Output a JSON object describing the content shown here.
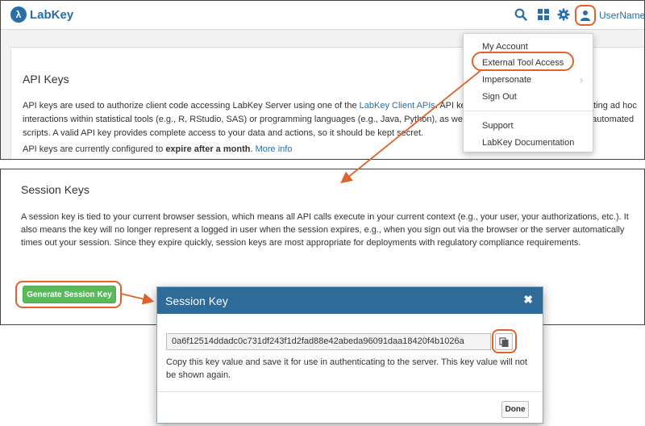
{
  "header": {
    "logo_text": "LabKey",
    "username": "UserName"
  },
  "api_keys": {
    "title": "API Keys",
    "text_part1": "API keys are used to authorize client code accessing LabKey Server using one of the ",
    "link_client_apis": "LabKey Client APIs",
    "text_part2": ". API keys are appropriate for authenticating ad hoc interactions within statistical tools (e.g., R, RStudio, SAS) or programming languages (e.g., Java, Python), as well as authenticating API use from automated scripts. A valid API key provides complete access to your data and actions, so it should be kept secret.",
    "config_text": "API keys are currently configured to ",
    "config_bold": "expire after a month",
    "config_period": ".",
    "more_info_link": "More info"
  },
  "user_menu": {
    "items": [
      {
        "label": "My Account"
      },
      {
        "label": "External Tool Access"
      },
      {
        "label": "Impersonate"
      },
      {
        "label": "Sign Out"
      },
      {
        "label": "Support"
      },
      {
        "label": "LabKey Documentation"
      }
    ],
    "submenu_chevron": "›"
  },
  "session_keys": {
    "title": "Session Keys",
    "text": "A session key is tied to your current browser session, which means all API calls execute in your current context (e.g., your user, your authorizations, etc.). It also means the key will no longer represent a logged in user when the session expires, e.g., when you sign out via the browser or the server automatically times out your session. Since they expire quickly, session keys are most appropriate for deployments with regulatory compliance requirements.",
    "generate_button": "Generate Session Key"
  },
  "modal": {
    "title": "Session Key",
    "close_glyph": "✖",
    "key_value": "0a6f12514ddadc0c731df243f1d2fad88e42abeda96091daa18420f4b1026a",
    "note": "Copy this key value and save it for use in authenticating to the server. This key value will not be shown again.",
    "done_button": "Done"
  },
  "colors": {
    "brand_blue": "#2a6ea8",
    "modal_header": "#2f6b98",
    "callout_orange": "#e0622a",
    "generate_green": "#5cb85c"
  },
  "icons": [
    "search-icon",
    "apps-grid-icon",
    "gear-icon",
    "user-icon",
    "copy-icon",
    "close-icon",
    "chevron-right-icon"
  ]
}
